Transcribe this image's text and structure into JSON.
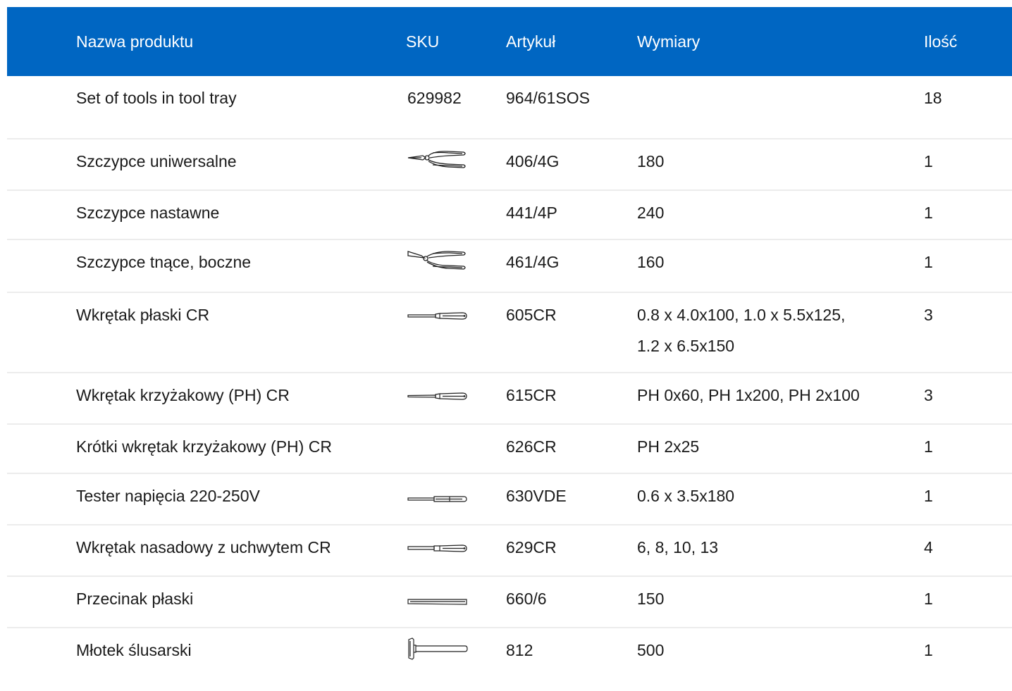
{
  "table": {
    "headers": {
      "name": "Nazwa produktu",
      "sku": "SKU",
      "article": "Artykuł",
      "dimensions": "Wymiary",
      "quantity": "Ilość"
    },
    "rows": [
      {
        "name": "Set of tools in tool tray",
        "sku": "629982",
        "sku_icon": "",
        "article": "964/61SOS",
        "dimensions": "",
        "quantity": "18"
      },
      {
        "name": "Szczypce uniwersalne",
        "sku": "",
        "sku_icon": "combination-pliers-icon",
        "article": "406/4G",
        "dimensions": "180",
        "quantity": "1"
      },
      {
        "name": "Szczypce nastawne",
        "sku": "",
        "sku_icon": "",
        "article": "441/4P",
        "dimensions": "240",
        "quantity": "1"
      },
      {
        "name": "Szczypce tnące, boczne",
        "sku": "",
        "sku_icon": "side-cutters-icon",
        "article": "461/4G",
        "dimensions": "160",
        "quantity": "1"
      },
      {
        "name": "Wkrętak płaski CR",
        "sku": "",
        "sku_icon": "flat-screwdriver-icon",
        "article": "605CR",
        "dimensions": "0.8 x 4.0x100, 1.0 x 5.5x125, 1.2 x 6.5x150",
        "quantity": "3"
      },
      {
        "name": "Wkrętak krzyżakowy (PH) CR",
        "sku": "",
        "sku_icon": "phillips-screwdriver-icon",
        "article": "615CR",
        "dimensions": "PH 0x60, PH 1x200, PH 2x100",
        "quantity": "3"
      },
      {
        "name": "Krótki wkrętak krzyżakowy (PH) CR",
        "sku": "",
        "sku_icon": "",
        "article": "626CR",
        "dimensions": "PH 2x25",
        "quantity": "1"
      },
      {
        "name": "Tester napięcia 220-250V",
        "sku": "",
        "sku_icon": "voltage-tester-icon",
        "article": "630VDE",
        "dimensions": "0.6 x 3.5x180",
        "quantity": "1"
      },
      {
        "name": "Wkrętak nasadowy z uchwytem CR",
        "sku": "",
        "sku_icon": "nut-driver-icon",
        "article": "629CR",
        "dimensions": "6, 8, 10, 13",
        "quantity": "4"
      },
      {
        "name": "Przecinak płaski",
        "sku": "",
        "sku_icon": "flat-chisel-icon",
        "article": "660/6",
        "dimensions": "150",
        "quantity": "1"
      },
      {
        "name": "Młotek ślusarski",
        "sku": "",
        "sku_icon": "hammer-icon",
        "article": "812",
        "dimensions": "500",
        "quantity": "1"
      }
    ]
  },
  "colors": {
    "header_bg": "#0066c2",
    "header_text": "#ffffff",
    "row_divider": "#ececec"
  }
}
